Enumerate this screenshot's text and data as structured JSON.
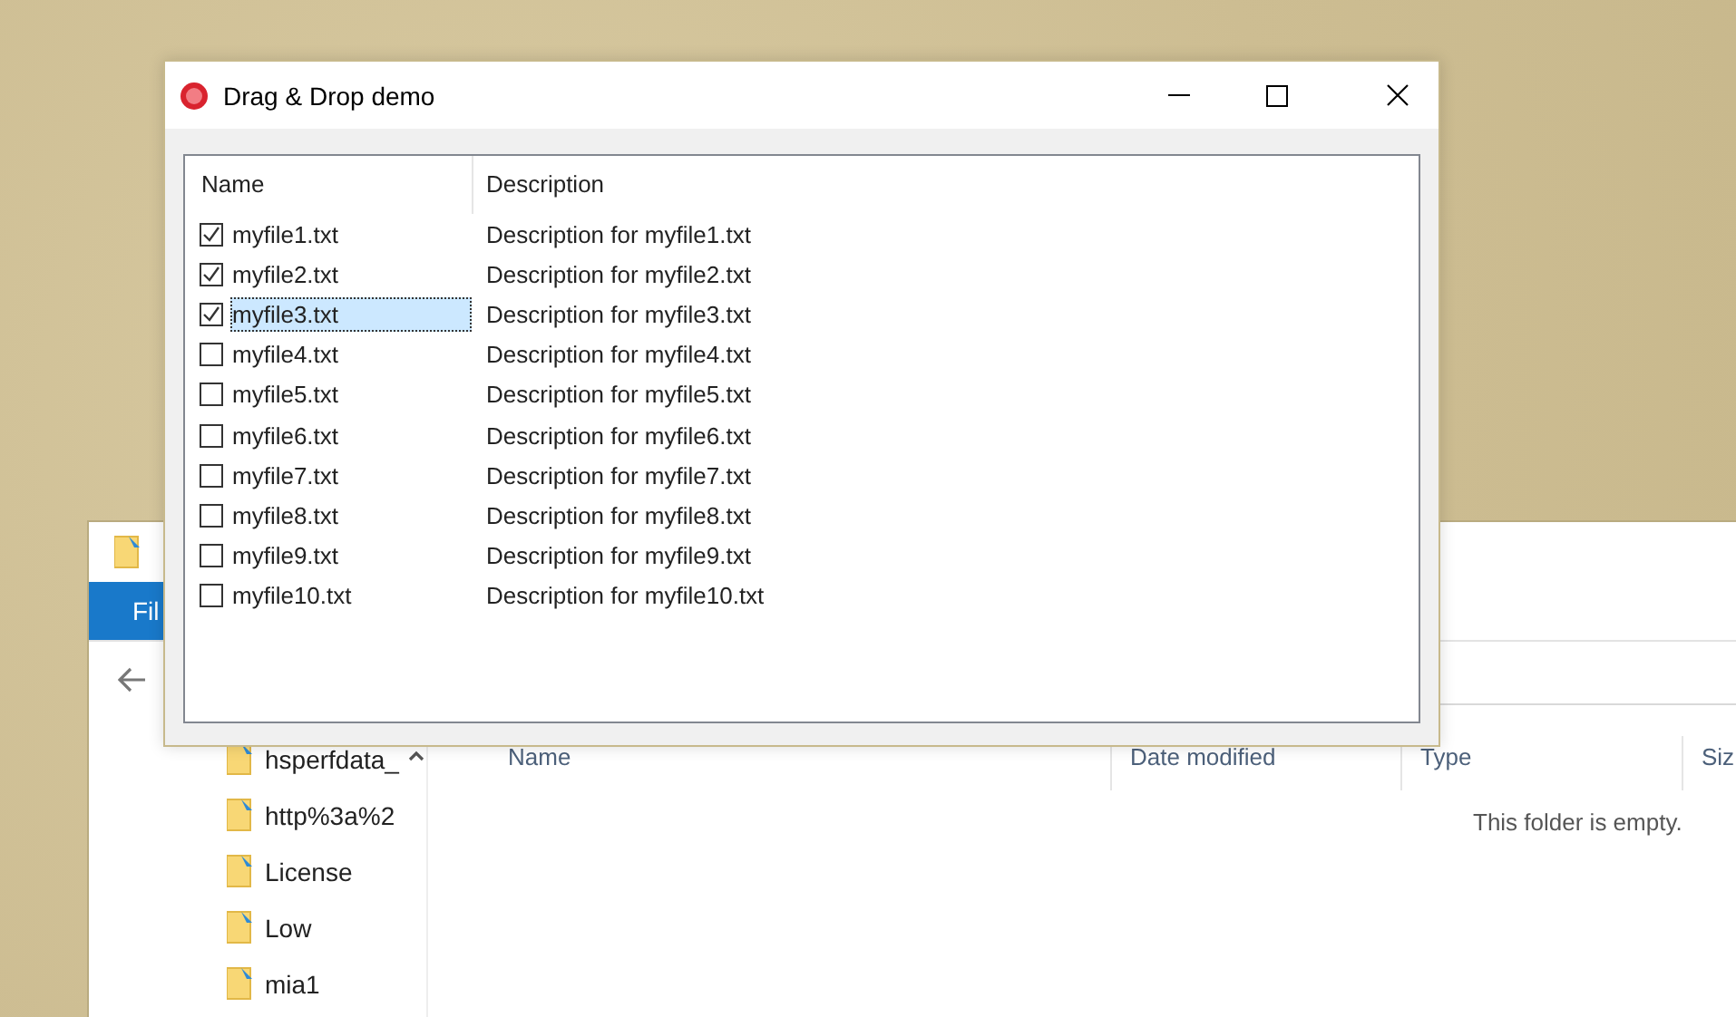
{
  "explorer": {
    "ribbon_tab": "Fil",
    "nav_items": [
      "hsperfdata_",
      "http%3a%2",
      "License",
      "Low",
      "mia1"
    ],
    "columns": [
      "Name",
      "Date modified",
      "Type",
      "Siz"
    ],
    "empty_message": "This folder is empty."
  },
  "dialog": {
    "title": "Drag & Drop demo",
    "columns": [
      "Name",
      "Description"
    ],
    "rows": [
      {
        "name": "myfile1.txt",
        "description": "Description for myfile1.txt",
        "checked": true,
        "selected": false
      },
      {
        "name": "myfile2.txt",
        "description": "Description for myfile2.txt",
        "checked": true,
        "selected": false
      },
      {
        "name": "myfile3.txt",
        "description": "Description for myfile3.txt",
        "checked": true,
        "selected": true
      },
      {
        "name": "myfile4.txt",
        "description": "Description for myfile4.txt",
        "checked": false,
        "selected": false
      },
      {
        "name": "myfile5.txt",
        "description": "Description for myfile5.txt",
        "checked": false,
        "selected": false
      },
      {
        "name": "myfile6.txt",
        "description": "Description for myfile6.txt",
        "checked": false,
        "selected": false
      },
      {
        "name": "myfile7.txt",
        "description": "Description for myfile7.txt",
        "checked": false,
        "selected": false
      },
      {
        "name": "myfile8.txt",
        "description": "Description for myfile8.txt",
        "checked": false,
        "selected": false
      },
      {
        "name": "myfile9.txt",
        "description": "Description for myfile9.txt",
        "checked": false,
        "selected": false
      },
      {
        "name": "myfile10.txt",
        "description": "Description for myfile10.txt",
        "checked": false,
        "selected": false
      }
    ]
  }
}
